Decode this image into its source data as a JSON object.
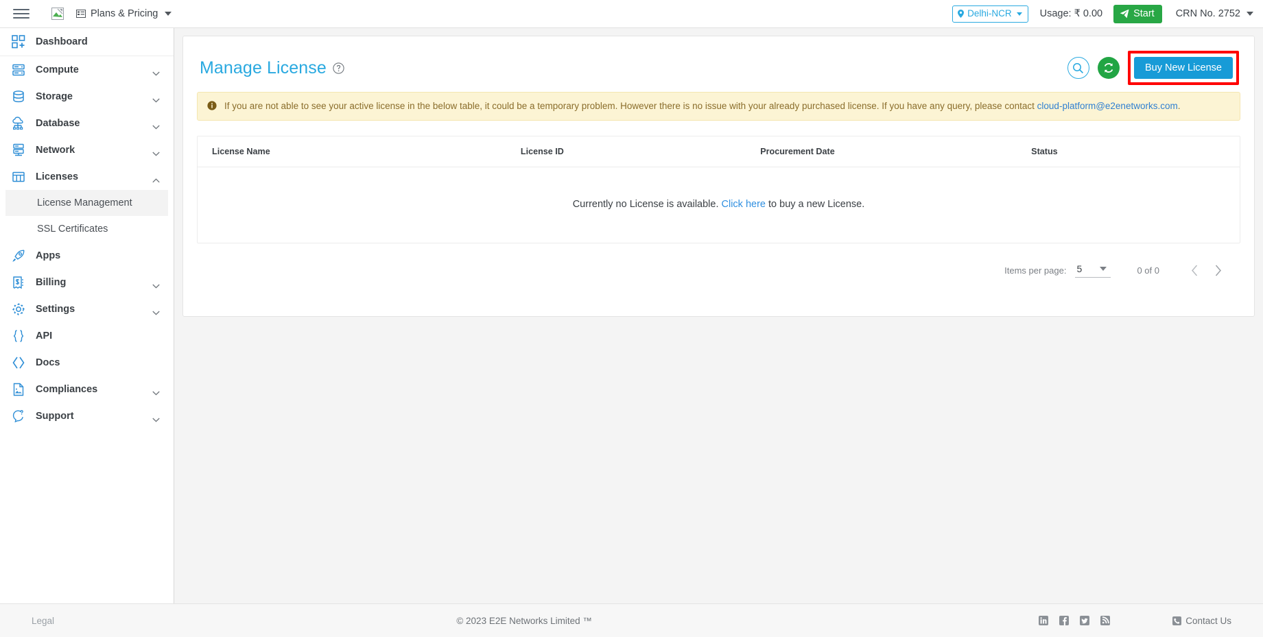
{
  "topbar": {
    "menu_icon": "hamburger-icon",
    "logo_icon": "broken-image-icon",
    "plans_label": "Plans & Pricing",
    "plans_icon": "list-icon",
    "region_label": "Delhi-NCR",
    "region_icon": "location-pin-icon",
    "usage_label": "Usage: ₹ 0.00",
    "start_label": "Start",
    "start_icon": "send-icon",
    "start_color": "#28a745",
    "crn_label": "CRN No. 2752"
  },
  "sidebar": {
    "items": [
      {
        "label": "Dashboard",
        "icon": "dashboard-grid-icon",
        "expandable": false
      },
      {
        "label": "Compute",
        "icon": "server-icon",
        "expandable": true,
        "expanded": false
      },
      {
        "label": "Storage",
        "icon": "database-stack-icon",
        "expandable": true,
        "expanded": false
      },
      {
        "label": "Database",
        "icon": "cloud-database-icon",
        "expandable": true,
        "expanded": false
      },
      {
        "label": "Network",
        "icon": "network-icon",
        "expandable": true,
        "expanded": false
      },
      {
        "label": "Licenses",
        "icon": "license-grid-icon",
        "expandable": true,
        "expanded": true
      },
      {
        "label": "Apps",
        "icon": "rocket-icon",
        "expandable": false
      },
      {
        "label": "Billing",
        "icon": "invoice-icon",
        "expandable": true,
        "expanded": false
      },
      {
        "label": "Settings",
        "icon": "gear-icon",
        "expandable": true,
        "expanded": false
      },
      {
        "label": "API",
        "icon": "curly-braces-icon",
        "expandable": false
      },
      {
        "label": "Docs",
        "icon": "code-brackets-icon",
        "expandable": false
      },
      {
        "label": "Compliances",
        "icon": "document-icon",
        "expandable": true,
        "expanded": false
      },
      {
        "label": "Support",
        "icon": "question-chat-icon",
        "expandable": true,
        "expanded": false
      }
    ],
    "licenses_subitems": [
      {
        "label": "License Management",
        "active": true
      },
      {
        "label": "SSL Certificates",
        "active": false
      }
    ]
  },
  "main": {
    "title": "Manage License",
    "title_color": "#29a9e0",
    "help_icon": "question-mark-circle-icon",
    "search_icon": "search-icon",
    "refresh_icon": "refresh-icon",
    "buy_button_label": "Buy New License",
    "buy_button_color": "#179bd7",
    "highlight_color": "#ff0000",
    "alert": {
      "icon": "info-circle-icon",
      "text_before": "If you are not able to see your active license in the below table, it could be a temporary problem. However there is no issue with your already purchased license. If you have any query, please contact",
      "link": "cloud-platform@e2enetworks.com",
      "text_after": "."
    },
    "table": {
      "columns": [
        "License Name",
        "License ID",
        "Procurement Date",
        "Status"
      ],
      "rows": [],
      "empty_text_before": "Currently no License is available.",
      "empty_link": "Click here",
      "empty_text_after": "to buy a new License."
    },
    "paginator": {
      "items_per_page_label": "Items per page:",
      "items_per_page_value": "5",
      "range_label": "0 of 0",
      "prev_icon": "chevron-left-icon",
      "next_icon": "chevron-right-icon"
    }
  },
  "footer": {
    "legal_label": "Legal",
    "copyright": "© 2023 E2E Networks Limited ™",
    "social": [
      {
        "name": "linkedin-icon"
      },
      {
        "name": "facebook-icon"
      },
      {
        "name": "twitter-icon"
      },
      {
        "name": "rss-icon"
      }
    ],
    "contact_label": "Contact Us",
    "contact_icon": "phone-icon"
  }
}
